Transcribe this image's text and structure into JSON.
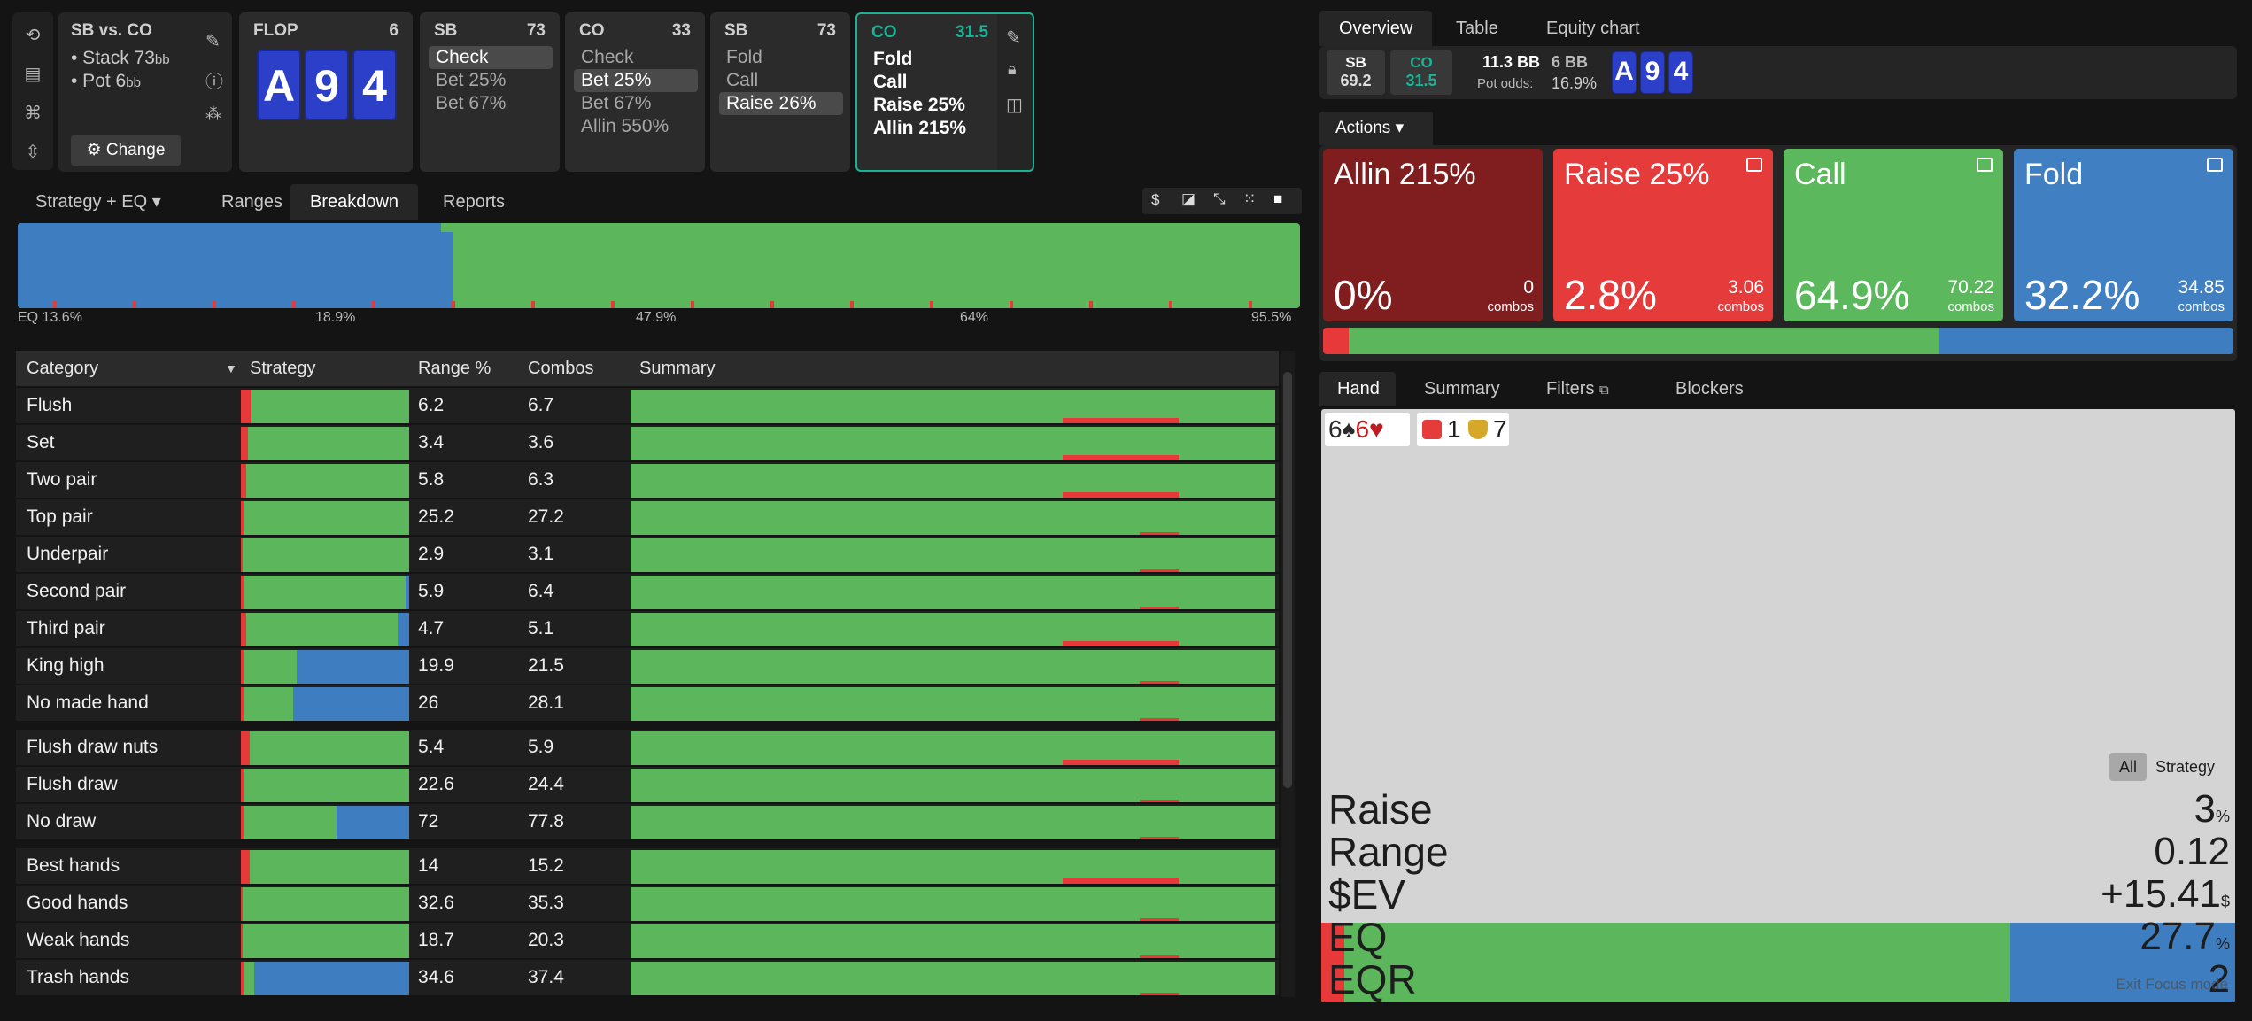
{
  "icons": [
    "undo-icon",
    "save-icon",
    "gamepad-icon",
    "align-icon"
  ],
  "matchup": {
    "title": "SB vs. CO",
    "stack_label": "• Stack 73",
    "stack_unit": "bb",
    "pot_label": "• Pot 6",
    "pot_unit": "bb",
    "change": "Change"
  },
  "flop": {
    "label": "FLOP",
    "value": "6",
    "cards": [
      "A",
      "9",
      "4"
    ]
  },
  "cards": [
    {
      "player": "SB",
      "stack": "73",
      "options": [
        "Check",
        "Bet 25%",
        "Bet 67%"
      ],
      "selected": 0
    },
    {
      "player": "CO",
      "stack": "33",
      "options": [
        "Check",
        "Bet 25%",
        "Bet 67%",
        "Allin 550%"
      ],
      "selected": 1
    },
    {
      "player": "SB",
      "stack": "73",
      "options": [
        "Fold",
        "Call",
        "Raise 26%"
      ],
      "selected": 2
    },
    {
      "player": "CO",
      "stack": "31.5",
      "options": [
        "Fold",
        "Call",
        "Raise 25%",
        "Allin 215%"
      ]
    }
  ],
  "tabs": {
    "strategy": "Strategy + EQ",
    "ranges": "Ranges",
    "breakdown": "Breakdown",
    "reports": "Reports"
  },
  "eq_axis": [
    "EQ 13.6%",
    "18.9%",
    "47.9%",
    "64%",
    "95.5%"
  ],
  "table": {
    "headers": [
      "Category",
      "Strategy",
      "Range %",
      "Combos",
      "Summary"
    ],
    "groups": [
      [
        {
          "name": "Flush",
          "range": "6.2",
          "combos": "6.7",
          "s": [
            6,
            94,
            0
          ]
        },
        {
          "name": "Set",
          "range": "3.4",
          "combos": "3.6",
          "s": [
            4,
            96,
            0
          ]
        },
        {
          "name": "Two pair",
          "range": "5.8",
          "combos": "6.3",
          "s": [
            3,
            97,
            0
          ]
        },
        {
          "name": "Top pair",
          "range": "25.2",
          "combos": "27.2",
          "s": [
            2,
            98,
            0
          ]
        },
        {
          "name": "Underpair",
          "range": "2.9",
          "combos": "3.1",
          "s": [
            1,
            99,
            0
          ]
        },
        {
          "name": "Second pair",
          "range": "5.9",
          "combos": "6.4",
          "s": [
            2,
            96,
            2
          ]
        },
        {
          "name": "Third pair",
          "range": "4.7",
          "combos": "5.1",
          "s": [
            3,
            90,
            7
          ]
        },
        {
          "name": "King high",
          "range": "19.9",
          "combos": "21.5",
          "s": [
            2,
            31,
            67
          ]
        },
        {
          "name": "No made hand",
          "range": "26",
          "combos": "28.1",
          "s": [
            2,
            29,
            69
          ]
        }
      ],
      [
        {
          "name": "Flush draw nuts",
          "range": "5.4",
          "combos": "5.9",
          "s": [
            5,
            95,
            0
          ]
        },
        {
          "name": "Flush draw",
          "range": "22.6",
          "combos": "24.4",
          "s": [
            2,
            98,
            0
          ]
        },
        {
          "name": "No draw",
          "range": "72",
          "combos": "77.8",
          "s": [
            2,
            55,
            43
          ]
        }
      ],
      [
        {
          "name": "Best hands",
          "range": "14",
          "combos": "15.2",
          "s": [
            5,
            95,
            0
          ]
        },
        {
          "name": "Good hands",
          "range": "32.6",
          "combos": "35.3",
          "s": [
            1,
            99,
            0
          ]
        },
        {
          "name": "Weak hands",
          "range": "18.7",
          "combos": "20.3",
          "s": [
            1,
            99,
            0
          ]
        },
        {
          "name": "Trash hands",
          "range": "34.6",
          "combos": "37.4",
          "s": [
            2,
            6,
            92
          ]
        }
      ]
    ]
  },
  "right_tabs": {
    "overview": "Overview",
    "table": "Table",
    "equity": "Equity chart"
  },
  "info": {
    "sb": "SB",
    "sb_val": "69.2",
    "co": "CO",
    "co_val": "31.5",
    "pot_bb": "11.3 BB",
    "call_bb": "6 BB",
    "pot_odds_label": "Pot odds:",
    "pot_odds": "16.9%",
    "cards": [
      "A",
      "9",
      "4"
    ]
  },
  "actions_btn": "Actions",
  "actions": [
    {
      "name": "Allin 215%",
      "pct": "0%",
      "combos": "0",
      "unit": "combos",
      "color": "#7f1d1f"
    },
    {
      "name": "Raise 25%",
      "pct": "2.8%",
      "combos": "3.06",
      "unit": "combos",
      "color": "#e63b3b"
    },
    {
      "name": "Call",
      "pct": "64.9%",
      "combos": "70.22",
      "unit": "combos",
      "color": "#5cb85c"
    },
    {
      "name": "Fold",
      "pct": "32.2%",
      "combos": "34.85",
      "unit": "combos",
      "color": "#3f7fc2"
    }
  ],
  "hand_tabs": {
    "hand": "Hand",
    "summary": "Summary",
    "filters": "Filters",
    "blockers": "Blockers"
  },
  "hand": {
    "cards": "6♠6♥",
    "blockers": [
      "1",
      "7"
    ],
    "toggle_all": "All",
    "toggle_strategy": "Strategy",
    "rows": [
      {
        "label": "Raise",
        "value": "3",
        "unit": "%"
      },
      {
        "label": "Range",
        "value": "0.12",
        "unit": ""
      },
      {
        "label": "$EV",
        "value": "+15.41",
        "unit": "$"
      },
      {
        "label": "EQ",
        "value": "27.7",
        "unit": "%"
      },
      {
        "label": "EQR",
        "value": "2",
        "unit": ""
      }
    ],
    "exit": "Exit Focus mode"
  }
}
